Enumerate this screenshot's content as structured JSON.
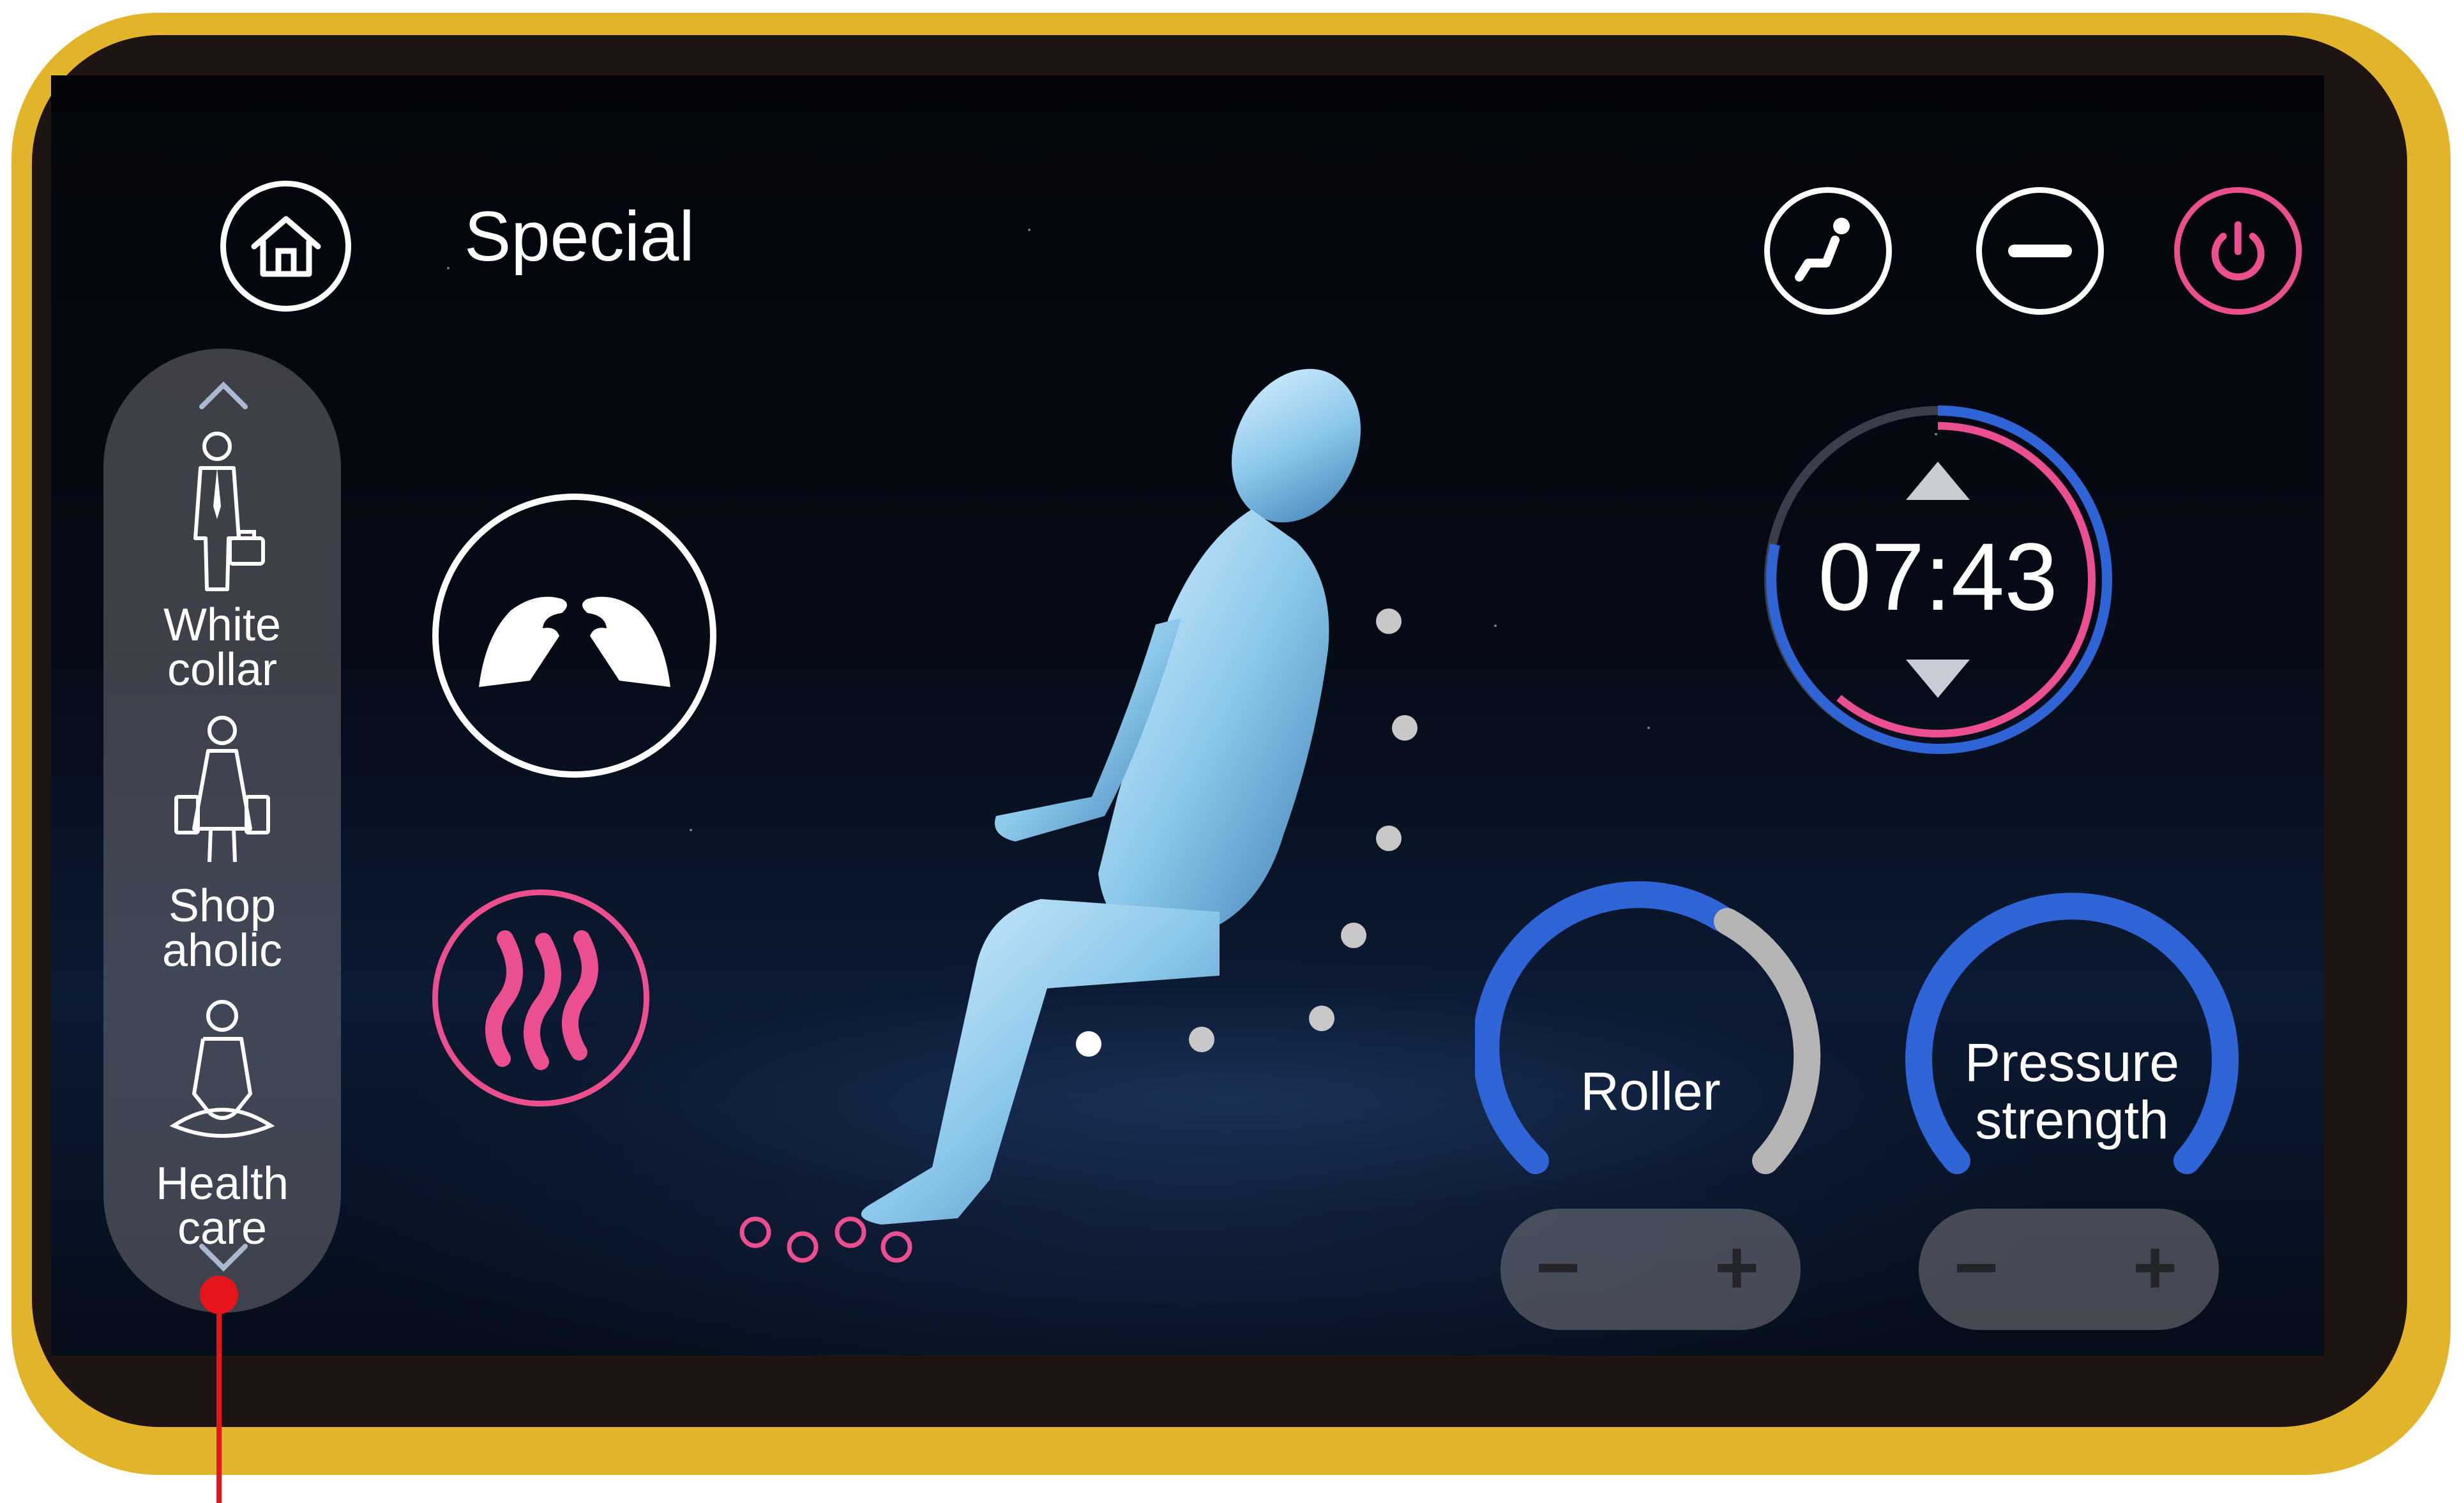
{
  "header": {
    "title": "Special"
  },
  "icons": {
    "home": "home-icon",
    "recline": "recline-icon",
    "minimize": "minus-icon",
    "power": "power-icon",
    "hands": "massage-hands-icon",
    "heat": "heat-icon"
  },
  "sidebar": {
    "items": [
      {
        "label_line1": "White",
        "label_line2": "collar"
      },
      {
        "label_line1": "Shop",
        "label_line2": "aholic"
      },
      {
        "label_line1": "Health",
        "label_line2": "care"
      }
    ]
  },
  "timer": {
    "value": "07:43"
  },
  "controls": {
    "roller": {
      "label": "Roller",
      "minus": "−",
      "plus": "+"
    },
    "pressure": {
      "label_line1": "Pressure",
      "label_line2": "strength",
      "minus": "−",
      "plus": "+"
    }
  },
  "colors": {
    "frame": "#e2b42a",
    "accent_pink": "#ec4f8f",
    "accent_blue": "#2f64d6",
    "gauge_grey": "#b4b4b4"
  }
}
